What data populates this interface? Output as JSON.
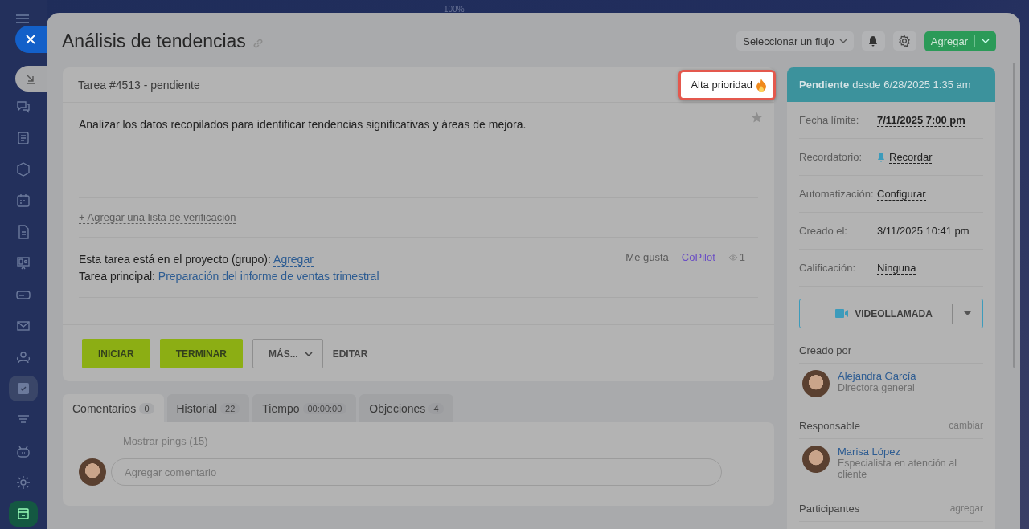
{
  "top": {
    "zoom": "100%"
  },
  "sidebar": {
    "items": [
      {
        "selected": false
      },
      {
        "selected": false
      },
      {
        "selected": false
      },
      {
        "selected": false
      },
      {
        "selected": false
      },
      {
        "selected": false
      },
      {
        "selected": false
      },
      {
        "selected": false
      },
      {
        "selected": false
      },
      {
        "selected": true
      },
      {
        "selected": false
      },
      {
        "selected": false
      },
      {
        "selected": false
      },
      {
        "selected": false
      }
    ]
  },
  "header": {
    "title": "Análisis de tendencias",
    "flow_select": "Seleccionar un flujo",
    "add_button": "Agregar"
  },
  "task": {
    "heading": "Tarea #4513 - pendiente",
    "priority": {
      "label": "Alta prioridad",
      "highlighted": true
    },
    "starred": false,
    "description": "Analizar los datos recopilados para identificar tendencias significativas y áreas de mejora.",
    "checklist_link": "+ Agregar una lista de verificación",
    "project_label": "Esta tarea está en el proyecto (grupo):",
    "project_link": "Agregar",
    "parent_label": "Tarea principal:",
    "parent_link": "Preparación del informe de ventas trimestral",
    "like": "Me gusta",
    "copilot": "CoPilot",
    "views": "1"
  },
  "actions": [
    {
      "kind": "primary",
      "label": "INICIAR"
    },
    {
      "kind": "primary",
      "label": "TERMINAR"
    },
    {
      "kind": "menu",
      "label": "MÁS..."
    },
    {
      "kind": "text",
      "label": "EDITAR"
    }
  ],
  "tabs": [
    {
      "label": "Comentarios",
      "count": "0",
      "selected": true
    },
    {
      "label": "Historial",
      "count": "22",
      "selected": false
    },
    {
      "label": "Tiempo",
      "count": "00:00:00",
      "selected": false
    },
    {
      "label": "Objeciones",
      "count": "4",
      "selected": false
    }
  ],
  "comments": {
    "pings": "Mostrar pings (15)",
    "placeholder": "Agregar comentario"
  },
  "side": {
    "status": "Pendiente",
    "since": "desde 6/28/2025 1:35 am",
    "fields": [
      {
        "kind": "date",
        "label": "Fecha límite:",
        "value": "7/11/2025 7:00 pm"
      },
      {
        "kind": "reminder",
        "label": "Recordatorio:",
        "value": "Recordar"
      },
      {
        "kind": "link",
        "label": "Automatización:",
        "value": "Configurar"
      },
      {
        "kind": "plain",
        "label": "Creado el:",
        "value": "3/11/2025 10:41 pm"
      },
      {
        "kind": "link",
        "label": "Calificación:",
        "value": "Ninguna"
      }
    ],
    "video_button": "VIDEOLLAMADA",
    "created_by": {
      "title": "Creado por",
      "name": "Alejandra García",
      "role": "Directora general"
    },
    "responsible": {
      "title": "Responsable",
      "action": "cambiar",
      "name": "Marisa López",
      "role": "Especialista en atención al cliente"
    },
    "participants": {
      "title": "Participantes",
      "action": "agregar"
    }
  }
}
